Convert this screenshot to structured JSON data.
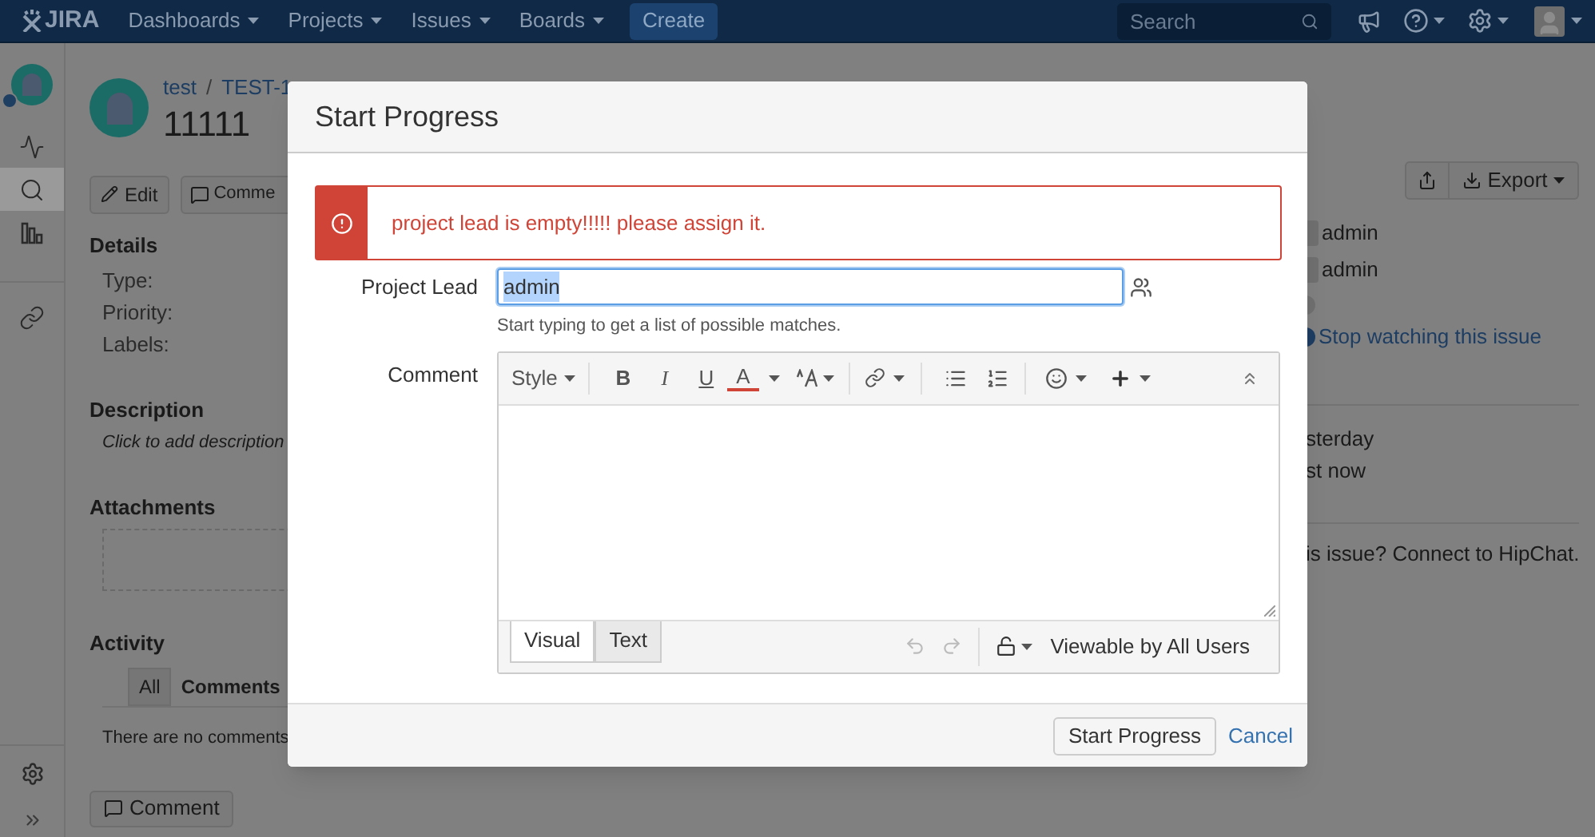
{
  "nav": {
    "logo": "JIRA",
    "menus": [
      {
        "label": "Dashboards"
      },
      {
        "label": "Projects"
      },
      {
        "label": "Issues"
      },
      {
        "label": "Boards"
      }
    ],
    "create": "Create",
    "search": {
      "placeholder": "Search"
    }
  },
  "sidebar": {
    "items": [
      {
        "kind": "activity",
        "selected": false
      },
      {
        "kind": "search",
        "selected": true
      },
      {
        "kind": "reports",
        "selected": false
      },
      {
        "kind": "link",
        "selected": false
      }
    ]
  },
  "issue": {
    "breadcrumb": {
      "project": "test",
      "separator": "/",
      "key": "TEST-1"
    },
    "title": "11111",
    "actions": {
      "edit": "Edit",
      "comment": "Comme",
      "export": "Export"
    },
    "details": {
      "heading": "Details",
      "fields": [
        "Type:",
        "Priority:",
        "Labels:"
      ]
    },
    "description": {
      "heading": "Description",
      "placeholder": "Click to add description"
    },
    "attachments": {
      "heading": "Attachments"
    },
    "activity": {
      "heading": "Activity",
      "tabs": [
        {
          "label": "All",
          "selected": false
        },
        {
          "label": "Comments",
          "selected": true
        }
      ],
      "empty": "There are no comments",
      "comment_button": "Comment"
    },
    "people": [
      "admin",
      "admin"
    ],
    "watch": "Stop watching this issue",
    "dates": [
      "sterday",
      "st now"
    ],
    "hipchat": "is issue? Connect to HipChat."
  },
  "dialog": {
    "title": "Start Progress",
    "error": "project lead is empty!!!!! please assign it.",
    "project_lead": {
      "label": "Project Lead",
      "value": "admin",
      "hint": "Start typing to get a list of possible matches."
    },
    "comment": {
      "label": "Comment",
      "toolbar": {
        "style": "Style",
        "bold": "B",
        "italic": "I",
        "underline": "U",
        "font_color": "A"
      },
      "tabs": [
        {
          "label": "Visual",
          "selected": true
        },
        {
          "label": "Text",
          "selected": false
        }
      ],
      "visibility": "Viewable by All Users"
    },
    "submit": "Start Progress",
    "cancel": "Cancel"
  }
}
